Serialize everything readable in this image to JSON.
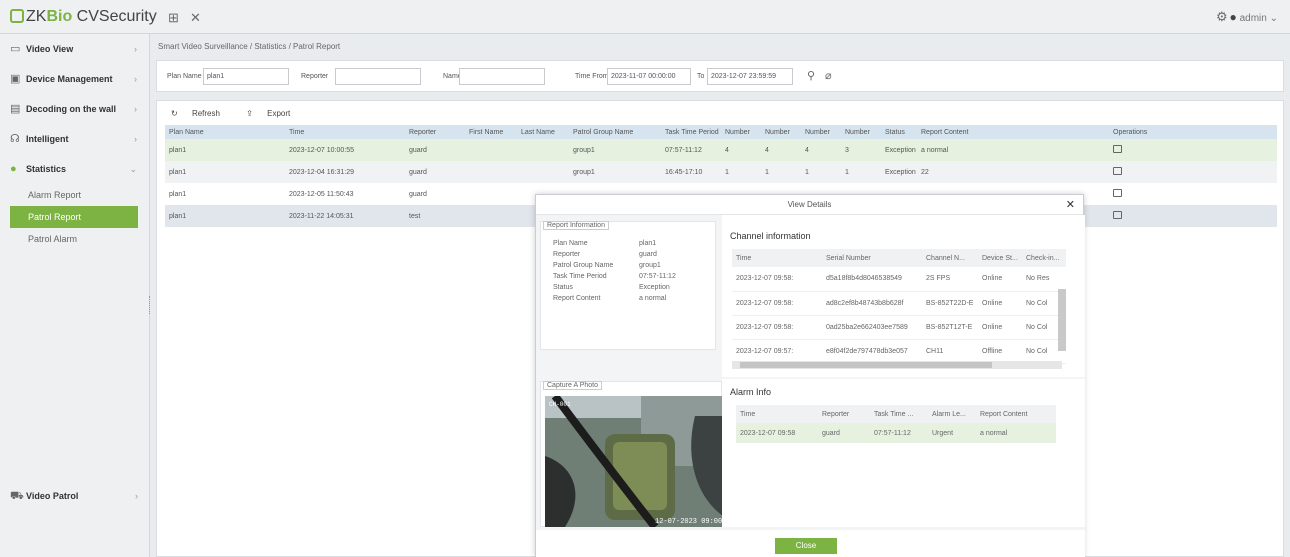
{
  "app": {
    "brand_prefix": "ZK",
    "brand_highlight": "Bio",
    "brand_suffix": " CVSecurity",
    "user": "admin"
  },
  "colors": {
    "accent": "#7cb342",
    "exception": "#e53935",
    "header_bg": "#d6e4ef"
  },
  "sidebar": {
    "items": [
      {
        "icon": "video-view-icon",
        "label": "Video View"
      },
      {
        "icon": "device-icon",
        "label": "Device Management"
      },
      {
        "icon": "decoding-icon",
        "label": "Decoding on the wall"
      },
      {
        "icon": "intelligent-icon",
        "label": "Intelligent"
      },
      {
        "icon": "statistics-icon",
        "label": "Statistics"
      }
    ],
    "sub_items": [
      "Alarm Report",
      "Patrol Report",
      "Patrol Alarm"
    ],
    "bottom_items": [
      {
        "icon": "video-patrol-icon",
        "label": "Video Patrol"
      }
    ]
  },
  "breadcrumb": "Smart Video Surveillance / Statistics / Patrol Report",
  "filters": {
    "plan_name_label": "Plan Name",
    "plan_name_value": "plan1",
    "reporter_label": "Reporter",
    "reporter_value": "",
    "name_label": "Name",
    "name_value": "",
    "time_from_label": "Time From",
    "time_from_value": "2023-11-07 00:00:00",
    "to_label": "To",
    "to_value": "2023-12-07 23:59:59"
  },
  "toolbar": {
    "refresh": "Refresh",
    "export": "Export"
  },
  "table": {
    "columns": [
      "Plan Name",
      "Time",
      "Reporter",
      "First Name",
      "Last Name",
      "Patrol Group Name",
      "Task Time Period",
      "Number",
      "Number",
      "Number",
      "Number",
      "Status",
      "Report Content",
      "Operations"
    ],
    "rows": [
      [
        "plan1",
        "2023-12-07 10:00:55",
        "guard",
        "",
        "",
        "group1",
        "07:57-11:12",
        "4",
        "4",
        "4",
        "3",
        "Exception",
        "a normal"
      ],
      [
        "plan1",
        "2023-12-04 16:31:29",
        "guard",
        "",
        "",
        "group1",
        "16:45-17:10",
        "1",
        "1",
        "1",
        "1",
        "Exception",
        "22"
      ],
      [
        "plan1",
        "2023-12-05 11:50:43",
        "guard",
        "",
        "",
        "",
        "",
        "",
        "",
        "",
        "",
        "",
        ""
      ],
      [
        "plan1",
        "2023-11-22 14:05:31",
        "test",
        "",
        "",
        "",
        "",
        "",
        "",
        "",
        "",
        "",
        ""
      ]
    ]
  },
  "modal": {
    "title": "View Details",
    "report_info_title": "Report Information",
    "report_info": [
      {
        "key": "Plan Name",
        "value": "plan1"
      },
      {
        "key": "Reporter",
        "value": "guard"
      },
      {
        "key": "Patrol Group Name",
        "value": "group1"
      },
      {
        "key": "Task Time Period",
        "value": "07:57-11:12"
      },
      {
        "key": "Status",
        "value": "Exception"
      },
      {
        "key": "Report Content",
        "value": "a normal"
      }
    ],
    "capture_title": "Capture A Photo",
    "cam_overlay_top": "CH-001",
    "cam_overlay_bottom": "12-07-2023 09:00",
    "channel_title": "Channel information",
    "channel_columns": [
      "Time",
      "Serial Number",
      "Channel N...",
      "Device St...",
      "Check-in..."
    ],
    "channel_rows": [
      [
        "2023-12-07 09:58:",
        "d5a18f8b4d8046538549",
        "2S FPS",
        "Online",
        "No Res"
      ],
      [
        "2023-12-07 09:58:",
        "ad8c2ef8b48743b8b628f",
        "BS-852T22D-E",
        "Online",
        "No Col"
      ],
      [
        "2023-12-07 09:58:",
        "0ad25ba2e662403ee7589",
        "BS-852T12T-E",
        "Online",
        "No Col"
      ],
      [
        "2023-12-07 09:57:",
        "e8f04f2de797478db3e057",
        "CH11",
        "Offline",
        "No Col"
      ]
    ],
    "alarm_title": "Alarm Info",
    "alarm_columns": [
      "Time",
      "Reporter",
      "Task Time ...",
      "Alarm Le...",
      "Report Content"
    ],
    "alarm_rows": [
      [
        "2023-12-07 09:58",
        "guard",
        "07:57-11:12",
        "Urgent",
        "a normal"
      ]
    ],
    "close_label": "Close"
  }
}
